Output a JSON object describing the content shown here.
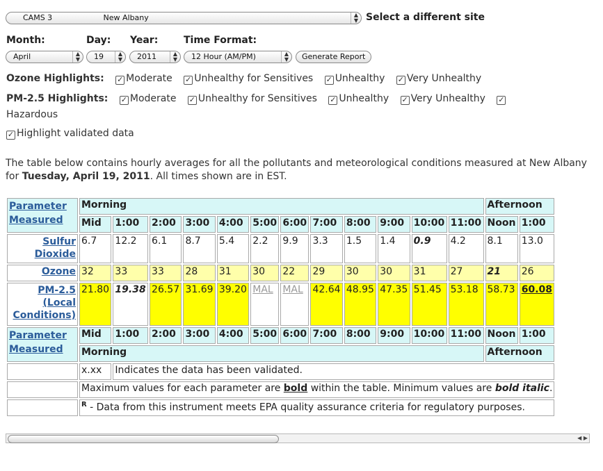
{
  "site": {
    "code": "CAMS 3",
    "name": "New Albany",
    "label": "Select a different site"
  },
  "date_controls": {
    "month_label": "Month:",
    "day_label": "Day:",
    "year_label": "Year:",
    "time_format_label": "Time Format:",
    "month_value": "April",
    "day_value": "19",
    "year_value": "2011",
    "time_format_value": "12 Hour (AM/PM)",
    "generate_button": "Generate Report"
  },
  "ozone_highlights": {
    "label": "Ozone Highlights:",
    "options": [
      "Moderate",
      "Unhealthy for Sensitives",
      "Unhealthy",
      "Very Unhealthy"
    ]
  },
  "pm25_highlights": {
    "label": "PM-2.5 Highlights:",
    "options": [
      "Moderate",
      "Unhealthy for Sensitives",
      "Unhealthy",
      "Very Unhealthy",
      "Hazardous"
    ]
  },
  "validated_option": "Highlight validated data",
  "check_mark": "✓",
  "intro": {
    "pre": "The table below contains hourly averages for all the pollutants and meteorological conditions measured at New Albany for ",
    "date": "Tuesday, April 19, 2011",
    "post": ". All times shown are in EST."
  },
  "table": {
    "param_header": "Parameter Measured",
    "morning": "Morning",
    "afternoon": "Afternoon",
    "hours": [
      "Mid",
      "1:00",
      "2:00",
      "3:00",
      "4:00",
      "5:00",
      "6:00",
      "7:00",
      "8:00",
      "9:00",
      "10:00",
      "11:00",
      "Noon",
      "1:00"
    ],
    "sulfur_dioxide": {
      "name": "Sulfur Dioxide",
      "values": [
        "6.7",
        "12.2",
        "6.1",
        "8.7",
        "5.4",
        "2.2",
        "9.9",
        "3.3",
        "1.5",
        "1.4",
        "0.9",
        "4.2",
        "8.1",
        "13.0"
      ]
    },
    "ozone": {
      "name": "Ozone",
      "values": [
        "32",
        "33",
        "33",
        "28",
        "31",
        "30",
        "22",
        "29",
        "30",
        "30",
        "31",
        "27",
        "21",
        "26"
      ]
    },
    "pm25": {
      "name": "PM-2.5 (Local Conditions)",
      "values": [
        "21.80",
        "19.38",
        "26.57",
        "31.69",
        "39.20",
        "MAL",
        "MAL",
        "42.64",
        "48.95",
        "47.35",
        "51.45",
        "53.18",
        "58.73",
        "60.08"
      ]
    },
    "notes": {
      "validated_sample": "x.xx",
      "validated_text": "Indicates the data has been validated.",
      "max_pre": "Maximum values for each parameter are ",
      "max_bold": "bold",
      "max_mid": " within the table. Minimum values are ",
      "max_bolditalic": "bold italic",
      "max_post": ".",
      "r_mark": "R",
      "r_text": " - Data from this instrument meets EPA quality assurance criteria for regulatory purposes."
    }
  }
}
